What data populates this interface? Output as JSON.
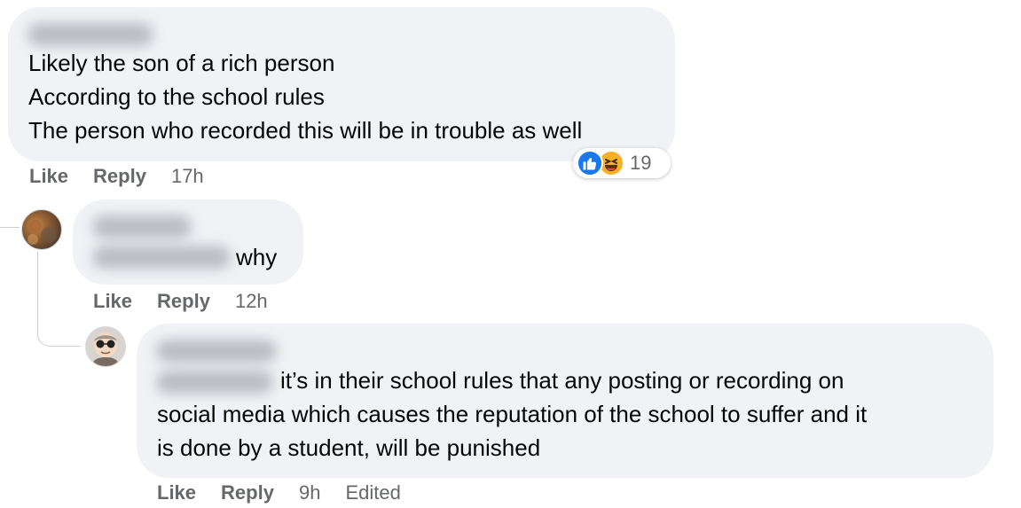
{
  "comment1": {
    "lines": [
      "Likely the son of a rich person",
      "According to the school rules",
      "The person who recorded this will be in trouble as well"
    ],
    "actions": {
      "like": "Like",
      "reply": "Reply",
      "time": "17h"
    },
    "reactions": {
      "icons": [
        "like-icon",
        "haha-icon"
      ],
      "count": "19"
    }
  },
  "comment2": {
    "text": "why",
    "actions": {
      "like": "Like",
      "reply": "Reply",
      "time": "12h"
    }
  },
  "comment3": {
    "lines": [
      "it’s in their school rules that any posting or recording on",
      "social media which causes the reputation of the school to suffer and it",
      "is done by a student, will be punished"
    ],
    "actions": {
      "like": "Like",
      "reply": "Reply",
      "time": "9h",
      "edited": "Edited"
    }
  },
  "colors": {
    "bubble": "#f0f2f5",
    "meta_text": "#65676b",
    "like_blue": "#1877f2",
    "haha_yellow": "#f7b125"
  }
}
